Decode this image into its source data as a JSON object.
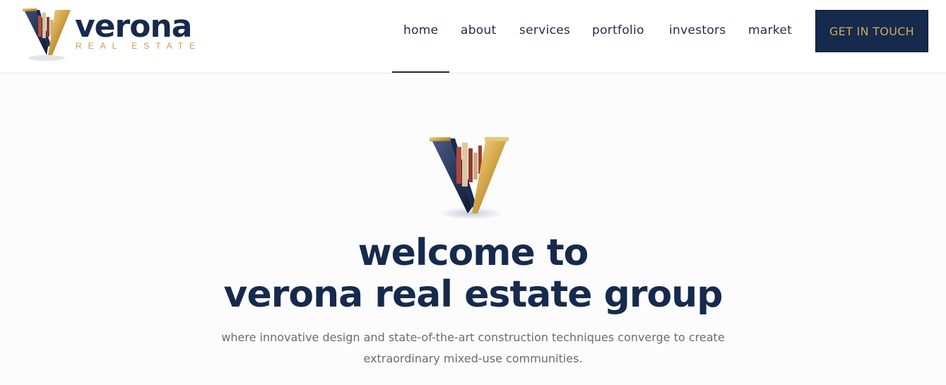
{
  "brand": {
    "name": "verona",
    "tagline": "REAL ESTATE"
  },
  "nav": {
    "items": [
      {
        "label": "home",
        "active": true
      },
      {
        "label": "about"
      },
      {
        "label": "services"
      },
      {
        "label": "portfolio"
      },
      {
        "label": "investors"
      },
      {
        "label": "market"
      }
    ],
    "cta_label": "GET IN TOUCH"
  },
  "hero": {
    "title_line1": "welcome to",
    "title_line2": "verona real estate group",
    "subtitle_line1": "where innovative design and state-of-the-art construction techniques converge to create",
    "subtitle_line2": "extraordinary mixed-use communities."
  },
  "colors": {
    "navy": "#162a4d",
    "gold": "#c49d55",
    "text_muted": "#6b6b73"
  }
}
